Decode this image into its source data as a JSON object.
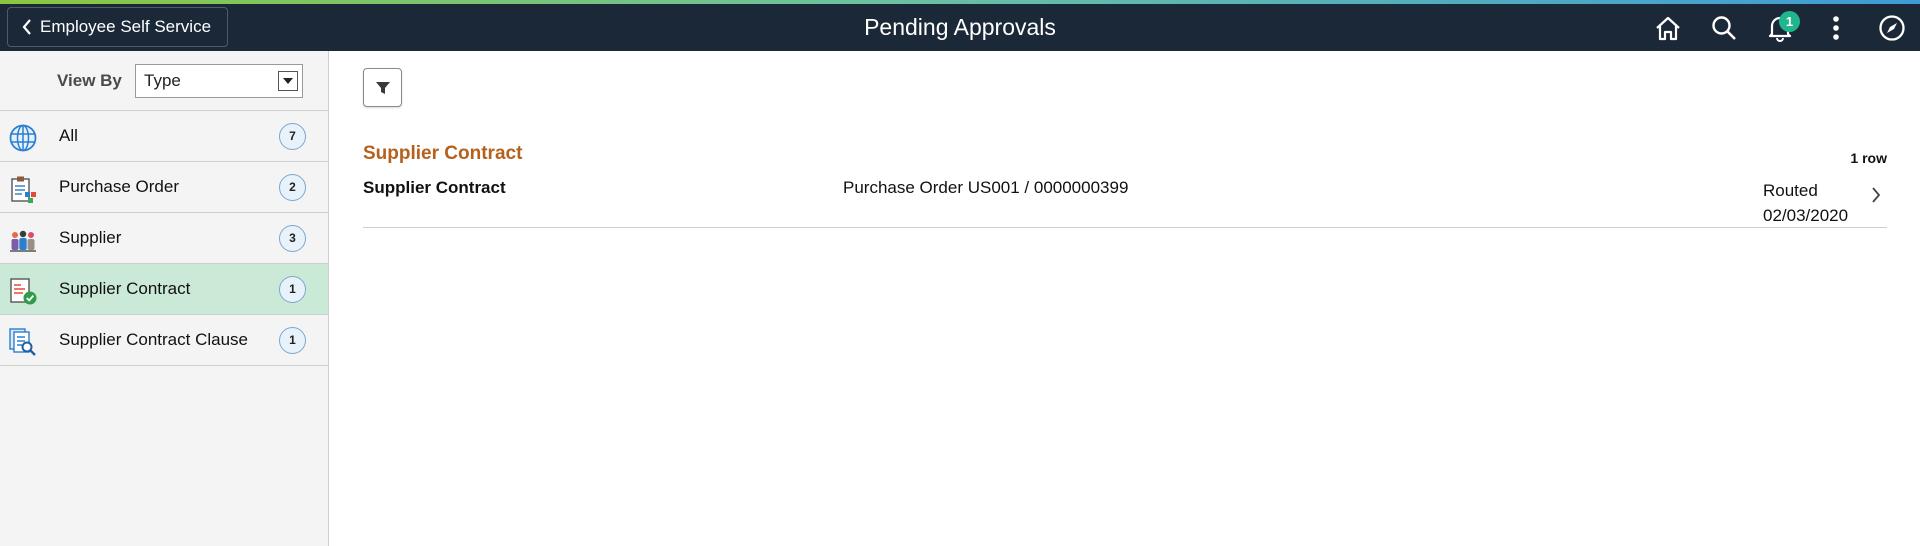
{
  "header": {
    "back_label": "Employee Self Service",
    "title": "Pending Approvals",
    "notifications_count": "1",
    "icons": [
      "home-icon",
      "search-icon",
      "bell-icon",
      "more-vertical-icon",
      "compass-icon"
    ],
    "colors": {
      "bar": "#1b2838",
      "badge": "#1fb68e"
    }
  },
  "sidebar": {
    "view_by_label": "View By",
    "view_by_value": "Type",
    "items": [
      {
        "label": "All",
        "count": "7",
        "icon": "globe-icon"
      },
      {
        "label": "Purchase Order",
        "count": "2",
        "icon": "clipboard-icon"
      },
      {
        "label": "Supplier",
        "count": "3",
        "icon": "people-icon"
      },
      {
        "label": "Supplier Contract",
        "count": "1",
        "icon": "contract-check-icon",
        "selected": true
      },
      {
        "label": "Supplier Contract Clause",
        "count": "1",
        "icon": "document-search-icon"
      }
    ]
  },
  "main": {
    "group_title": "Supplier Contract",
    "row_count": "1 row",
    "rows": [
      {
        "type": "Supplier Contract",
        "description": "Purchase Order US001 / 0000000399",
        "status": "Routed",
        "date": "02/03/2020"
      }
    ],
    "colors": {
      "group_title": "#b5611b",
      "selected_row": "#cbe9d7"
    }
  }
}
